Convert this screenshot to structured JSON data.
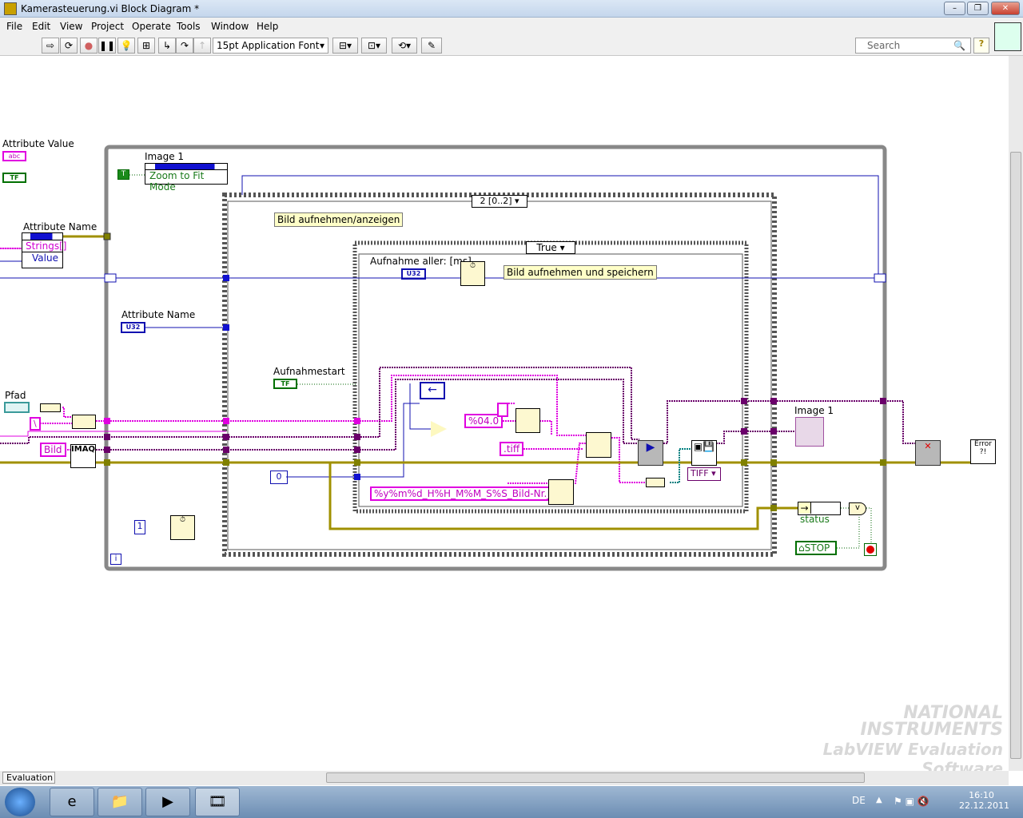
{
  "window": {
    "title": "Kamerasteuerung.vi Block Diagram *"
  },
  "menu": [
    "File",
    "Edit",
    "View",
    "Project",
    "Operate",
    "Tools",
    "Window",
    "Help"
  ],
  "toolbar": {
    "font": "15pt Application Font",
    "search_placeholder": "Search",
    "help": "?"
  },
  "diagram": {
    "attr_value_label": "Attribute Value",
    "attr_value_abc": "abc",
    "attr_value_tf": "TF",
    "attr_name_node_label": "Attribute Name",
    "attr_name_strings": "Strings[]",
    "attr_name_value": "Value",
    "image1_label": "Image 1",
    "zoom_fit": "Zoom to Fit Mode",
    "true_const": "T",
    "attr_name2_label": "Attribute Name",
    "u32": "U32",
    "sequence_selector": "2 [0..2]",
    "seq_comment": "Bild aufnehmen/anzeigen",
    "case_selector": "True",
    "aufnahme_label": "Aufnahme aller: [ms]",
    "case_comment": "Bild aufnehmen und speichern",
    "aufnahmestart_label": "Aufnahmestart",
    "tf": "TF",
    "pfad_label": "Pfad",
    "backslash": "\\",
    "bild": "Bild",
    "imaq": "IMAQ",
    "zero": "0",
    "one": "1",
    "format": "%04.0",
    "tiff_ext": ".tiff",
    "time_format": "%y%m%d_H%H_M%M_S%S_Bild-Nr._",
    "tiff_sel": "TIFF",
    "image1_indicator_label": "Image 1",
    "status": "status",
    "stop": "STOP",
    "error": "Error ?!",
    "iteration": "i"
  },
  "watermark": {
    "line1": "NATIONAL",
    "line2": "INSTRUMENTS",
    "line3": "LabVIEW Evaluation Software"
  },
  "statusbar": {
    "label": "Evaluation"
  },
  "taskbar": {
    "lang": "DE",
    "time": "16:10",
    "date": "22.12.2011"
  },
  "colors": {
    "string": "#e000e0",
    "error": "#a09000",
    "int": "#1010b0",
    "image": "#6a006a",
    "bool": "#006600"
  }
}
